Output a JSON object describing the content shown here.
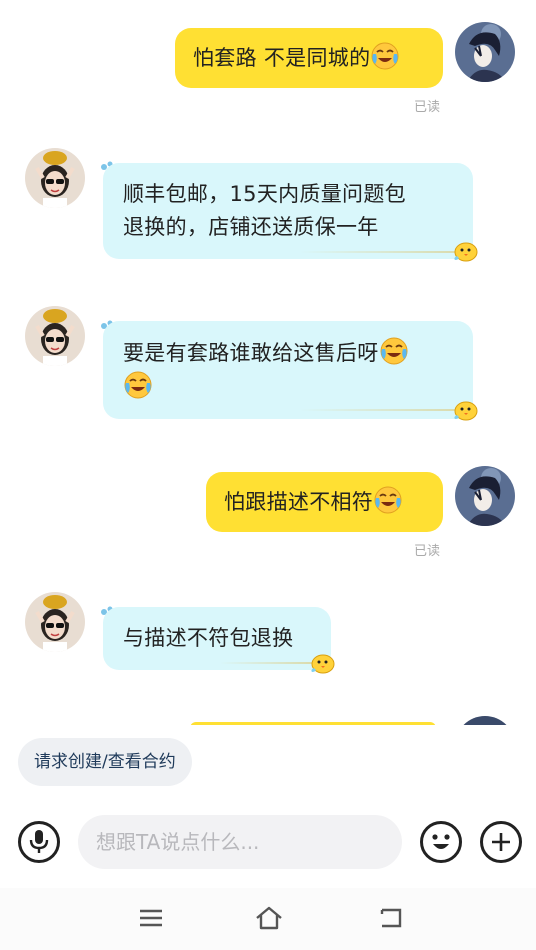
{
  "messages": [
    {
      "side": "me",
      "text": "怕套路 不是同城的",
      "emoji": "crying-laugh",
      "status": "已读"
    },
    {
      "side": "them",
      "lines": [
        "顺丰包邮，15天内质量问题包",
        "退换的，店铺还送质保一年"
      ]
    },
    {
      "side": "them",
      "lines": [
        "要是有套路谁敢给这售后呀",
        ""
      ],
      "emoji": "crying-laugh"
    },
    {
      "side": "me",
      "text": "怕跟描述不相符",
      "emoji": "crying-laugh",
      "status": "已读"
    },
    {
      "side": "them",
      "text": "与描述不符包退换"
    }
  ],
  "contract_chip": "请求创建/查看合约",
  "input": {
    "placeholder": "想跟TA说点什么..."
  },
  "icons": {
    "mic": "microphone-icon",
    "emoji": "smiley-icon",
    "plus": "plus-icon",
    "nav": [
      "menu-icon",
      "home-icon",
      "back-icon"
    ]
  },
  "colors": {
    "my_bubble": "#ffe033",
    "their_bubble": "#d9f7fb",
    "read_status": "#aaaaaa",
    "chip_bg": "#eef0f3"
  }
}
